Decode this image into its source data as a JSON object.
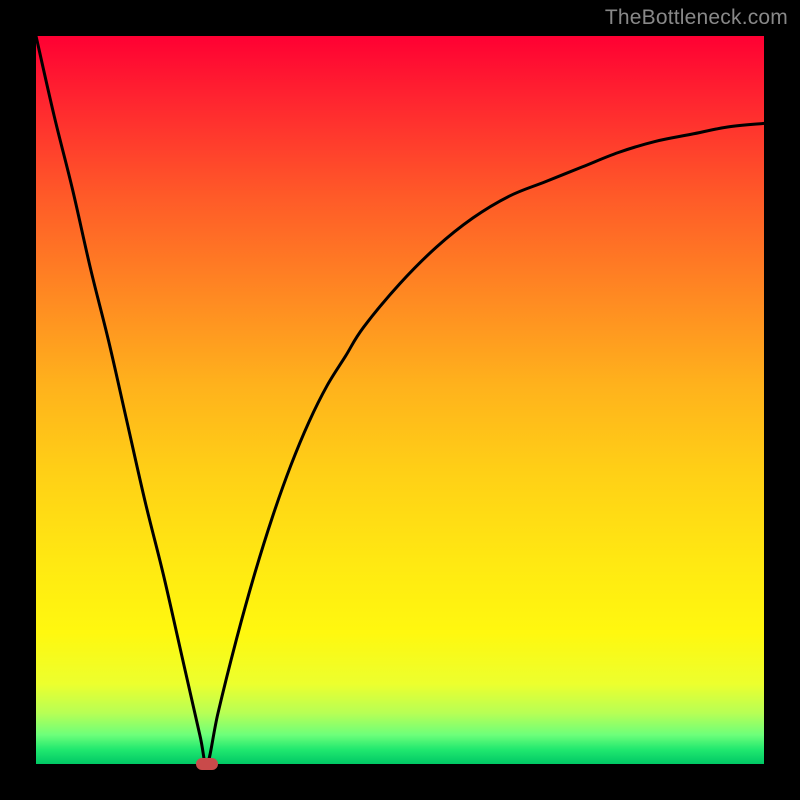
{
  "attribution": "TheBottleneck.com",
  "chart_data": {
    "type": "line",
    "title": "",
    "xlabel": "",
    "ylabel": "",
    "xlim": [
      0,
      100
    ],
    "ylim": [
      0,
      100
    ],
    "series": [
      {
        "name": "bottleneck-curve",
        "x": [
          0,
          2.5,
          5,
          7.5,
          10,
          12.5,
          15,
          17.5,
          20,
          22.5,
          23.5,
          25,
          27.5,
          30,
          32.5,
          35,
          37.5,
          40,
          42.5,
          45,
          50,
          55,
          60,
          65,
          70,
          75,
          80,
          85,
          90,
          95,
          100
        ],
        "values": [
          100,
          89,
          79,
          68,
          58,
          47,
          36,
          26,
          15,
          4,
          0,
          7,
          17,
          26,
          34,
          41,
          47,
          52,
          56,
          60,
          66,
          71,
          75,
          78,
          80,
          82,
          84,
          85.5,
          86.5,
          87.5,
          88
        ]
      }
    ],
    "minimum_point": {
      "x": 23.5,
      "y": 0
    },
    "gradient_colors": {
      "top": "#ff0033",
      "mid": "#ffeb10",
      "bottom": "#00c865"
    },
    "marker_color": "#c94a4a",
    "curve_color": "#000000"
  }
}
